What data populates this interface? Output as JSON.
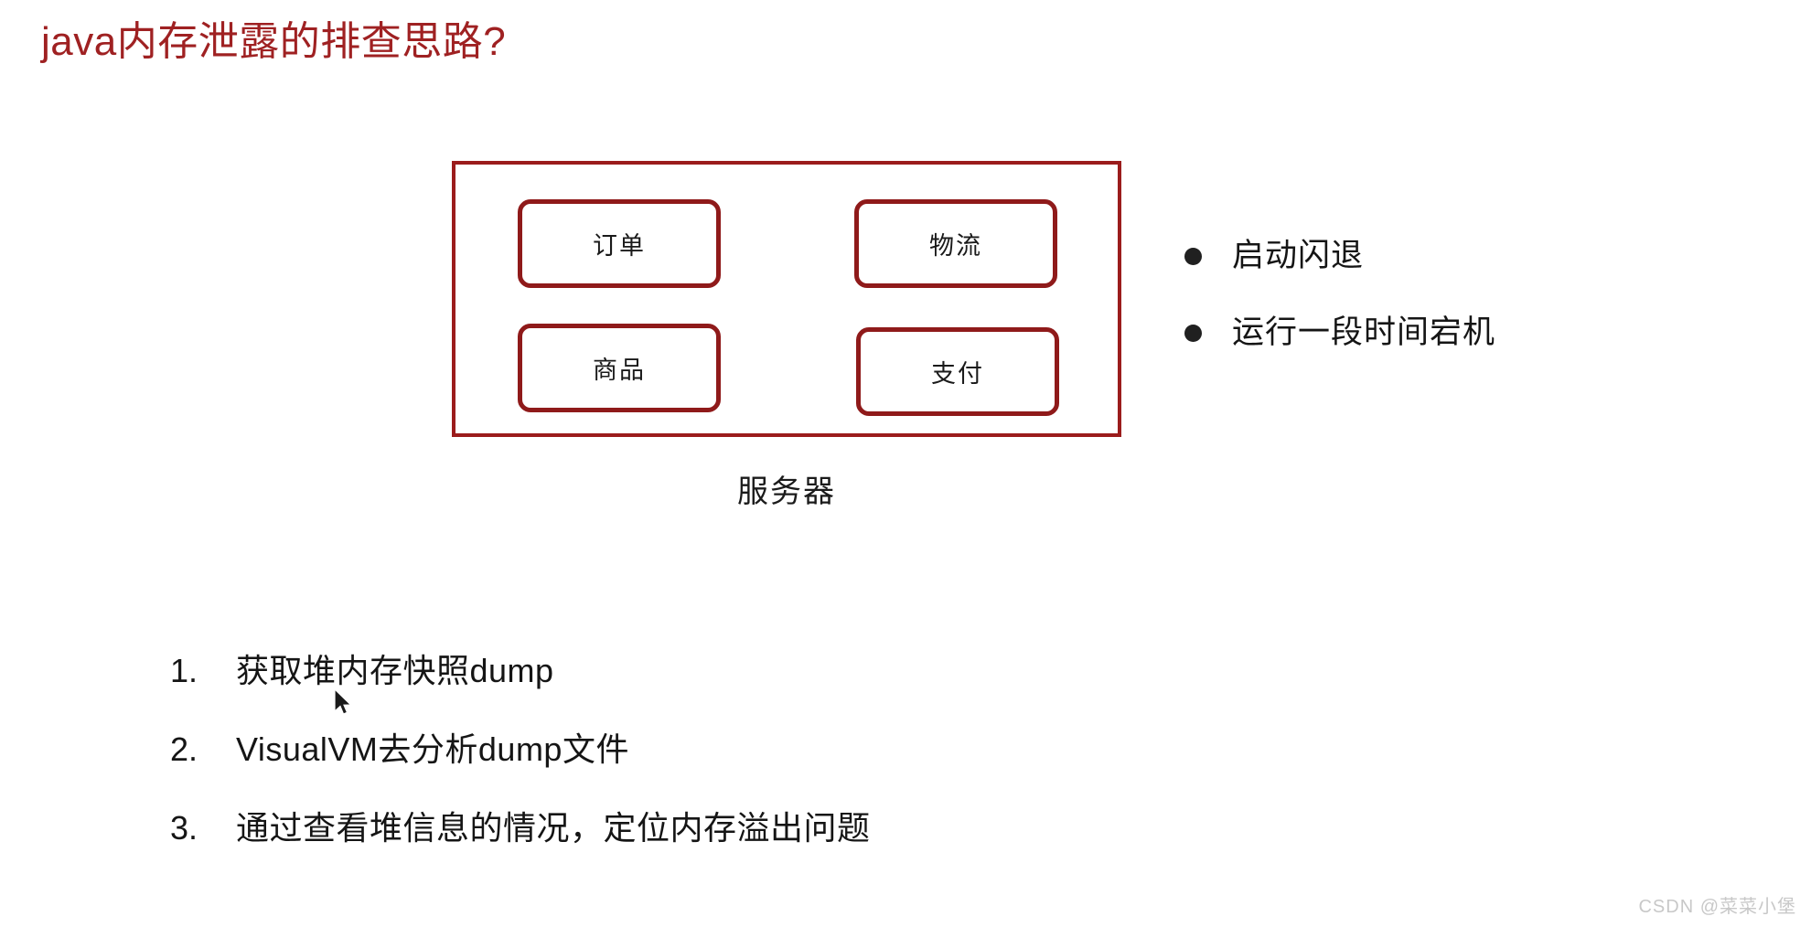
{
  "slide": {
    "title": "java内存泄露的排查思路?",
    "title_color": "#9f2122"
  },
  "diagram": {
    "container_label": "服务器",
    "border_color": "#9b1c1c",
    "services": [
      {
        "label": "订单"
      },
      {
        "label": "物流"
      },
      {
        "label": "商品"
      },
      {
        "label": "支付"
      }
    ]
  },
  "symptoms": {
    "items": [
      {
        "text": "启动闪退"
      },
      {
        "text": "运行一段时间宕机"
      }
    ],
    "bullet_color": "#202020"
  },
  "steps": {
    "items": [
      {
        "num": "1.",
        "text": "获取堆内存快照dump"
      },
      {
        "num": "2.",
        "text": "VisualVM去分析dump文件"
      },
      {
        "num": "3.",
        "text": "通过查看堆信息的情况，定位内存溢出问题"
      }
    ]
  },
  "cursor": {
    "icon": "mouse-pointer-icon"
  },
  "watermark": {
    "text": "CSDN @菜菜小堡"
  }
}
